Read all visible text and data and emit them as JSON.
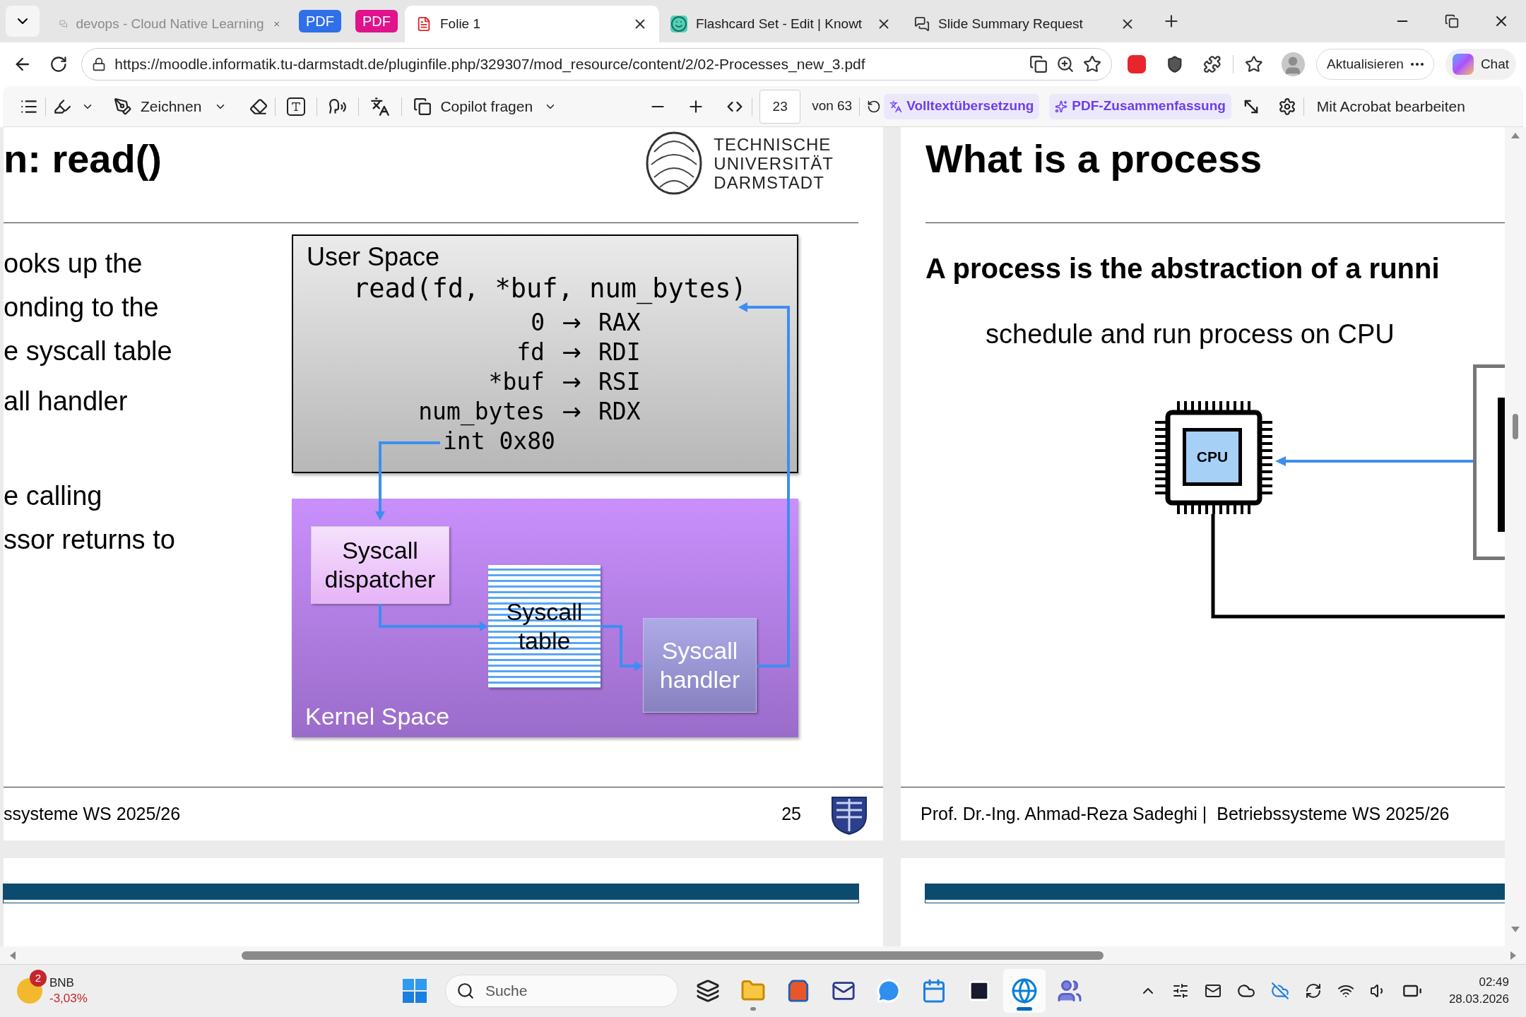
{
  "tabs": [
    {
      "kind": "tab",
      "title": "devops - Cloud Native Learning",
      "selected": false,
      "dimmed": true
    },
    {
      "kind": "group",
      "title": "PDF",
      "color": "#2f6fe8"
    },
    {
      "kind": "group",
      "title": "PDF",
      "color": "#e0128c"
    },
    {
      "kind": "tab",
      "title": "Folie 1",
      "selected": true,
      "dimmed": false
    },
    {
      "kind": "tab",
      "title": "Flashcard Set - Edit | Knowt",
      "selected": false,
      "dimmed": false
    },
    {
      "kind": "tab",
      "title": "Slide Summary Request",
      "selected": false,
      "dimmed": false
    }
  ],
  "address_bar": {
    "url": "https://moodle.informatik.tu-darmstadt.de/pluginfile.php/329307/mod_resource/content/2/02-Processes_new_3.pdf"
  },
  "browser_buttons": {
    "update": "Aktualisieren",
    "chat": "Chat"
  },
  "pdf_toolbar": {
    "draw": "Zeichnen",
    "copilot": "Copilot fragen",
    "page": "23",
    "page_count": "von 63",
    "translate": "Volltextübersetzung",
    "summary": "PDF-Zusammenfassung",
    "edit": "Mit Acrobat bearbeiten"
  },
  "left_slide": {
    "title": "n: read()",
    "logo_lines": [
      "TECHNISCHE",
      "UNIVERSITÄT",
      "DARMSTADT"
    ],
    "lines": [
      "ooks up the",
      "onding to the",
      "e syscall table",
      "all handler",
      "e calling",
      "ssor returns to"
    ],
    "diagram": {
      "user_label": "User Space",
      "call": "read(fd, *buf, num_bytes)",
      "registers": [
        {
          "source": "0",
          "arrow": "→",
          "target": "RAX"
        },
        {
          "source": "fd",
          "arrow": "→",
          "target": "RDI"
        },
        {
          "source": "*buf",
          "arrow": "→",
          "target": "RSI"
        },
        {
          "source": "num_bytes",
          "arrow": "→",
          "target": "RDX"
        }
      ],
      "interrupt": "int 0x80",
      "dispatcher": "Syscall dispatcher",
      "table": "Syscall table",
      "handler": "Syscall handler",
      "kernel_label": "Kernel Space"
    },
    "footer": "ssysteme WS 2025/26",
    "page_number": "25"
  },
  "right_slide": {
    "title": "What is a process",
    "headline": "A process is the abstraction of a runni",
    "subtitle": "schedule and run process on CPU",
    "chip_label": "CPU",
    "footer": "Prof. Dr.-Ing. Ahmad-Reza Sadeghi |  Betriebssysteme WS 2025/26"
  },
  "taskbar": {
    "widget": {
      "name": "BNB",
      "change": "-3,03%",
      "badge": "2"
    },
    "search_placeholder": "Suche",
    "apps": [
      {
        "kind": "taskview",
        "active": false,
        "running": false
      },
      {
        "kind": "explorer",
        "active": false,
        "running": true
      },
      {
        "kind": "store",
        "active": false,
        "running": false
      },
      {
        "kind": "mail",
        "active": false,
        "running": false
      },
      {
        "kind": "chat",
        "active": false,
        "running": false
      },
      {
        "kind": "calendar",
        "active": false,
        "running": false
      },
      {
        "kind": "ide",
        "active": false,
        "running": false
      },
      {
        "kind": "browser",
        "active": true,
        "running": true
      },
      {
        "kind": "teams",
        "active": false,
        "running": false
      }
    ],
    "clock": {
      "time": "02:49",
      "date": "28.03.2026"
    }
  }
}
